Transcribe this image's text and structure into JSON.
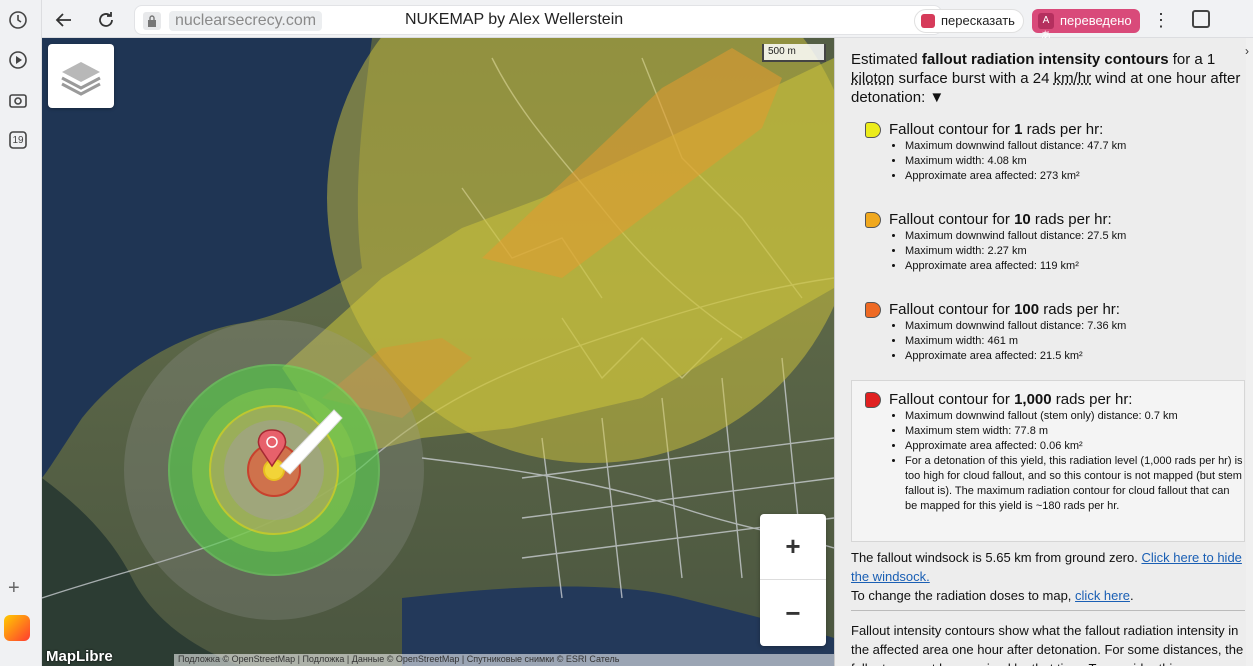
{
  "browser": {
    "domain": "nuclearsecrecy.com",
    "title": "NUKEMAP by Alex Wellerstein",
    "retell_label": "пересказать",
    "translated_label": "переведено",
    "sidebar_badge": "19",
    "back_icon": "arrow-left-icon",
    "reload_icon": "reload-icon"
  },
  "map": {
    "scale_label": "500 m",
    "zoom_in": "+",
    "zoom_out": "−",
    "logo": "MapLibre",
    "attribution": "Подложка © OpenStreetMap | Подложка | Данные © OpenStreetMap | Спутниковые снимки © ESRI Сатель"
  },
  "panel": {
    "intro_1": "Estimated ",
    "intro_bold": "fallout radiation intensity contours",
    "intro_2": " for a 1 ",
    "intro_kiloton": "kiloton",
    "intro_3": " surface burst with a 24 ",
    "intro_kmhr": "km/hr",
    "intro_4": " wind at one hour after detonation: ",
    "intro_toggle": "▼",
    "contours": [
      {
        "prefix": "Fallout contour for ",
        "value": "1",
        "suffix": " rads per hr:",
        "color": "#ecec1a",
        "items": [
          "Maximum downwind fallout distance: 47.7 km",
          "Maximum width: 4.08 km",
          "Approximate area affected: 273 km²"
        ]
      },
      {
        "prefix": "Fallout contour for ",
        "value": "10",
        "suffix": " rads per hr:",
        "color": "#f0a81e",
        "items": [
          "Maximum downwind fallout distance: 27.5 km",
          "Maximum width: 2.27 km",
          "Approximate area affected: 119 km²"
        ]
      },
      {
        "prefix": "Fallout contour for ",
        "value": "100",
        "suffix": " rads per hr:",
        "color": "#ee6a24",
        "items": [
          "Maximum downwind fallout distance: 7.36 km",
          "Maximum width: 461 m",
          "Approximate area affected: 21.5 km²"
        ]
      },
      {
        "prefix": "Fallout contour for ",
        "value": "1,000",
        "suffix": " rads per hr:",
        "color": "#e02020",
        "items": [
          "Maximum downwind fallout (stem only) distance: 0.7 km",
          "Maximum stem width: 77.8 m",
          "Approximate area affected: 0.06 km²",
          "For a detonation of this yield, this radiation level (1,000 rads per hr) is too high for cloud fallout, and so this contour is not mapped (but stem fallout is). The maximum radiation contour for cloud fallout that can be mapped for this yield is ~180 rads per hr."
        ]
      }
    ],
    "windsock_text": "The fallout windsock is 5.65 km from ground zero. ",
    "windsock_link": "Click here to hide the windsock.",
    "doses_text": "To change the radiation doses to map, ",
    "doses_link": "click here",
    "doses_end": ".",
    "note": "Fallout intensity contours show what the fallout radiation intensity in the affected area one hour after detonation. For some distances, the fallout may not have arrived by that time. To consider this"
  }
}
